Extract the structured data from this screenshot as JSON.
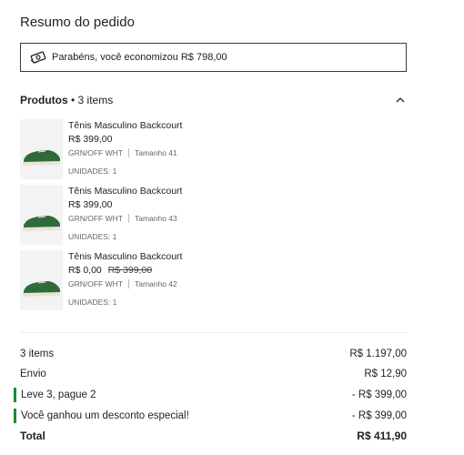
{
  "title": "Resumo do pedido",
  "savings": {
    "icon": "money-icon",
    "text": "Parabéns, você economizou R$ 798,00"
  },
  "products_header": {
    "label": "Produtos",
    "count": "• 3 items",
    "toggle_icon": "chevron-up-icon"
  },
  "products": [
    {
      "name": "Tênis Masculino Backcourt",
      "price": "R$ 399,00",
      "old_price": "",
      "color": "GRN/OFF WHT",
      "size": "Tamanho 41",
      "units": "UNIDADES: 1"
    },
    {
      "name": "Tênis Masculino Backcourt",
      "price": "R$ 399,00",
      "old_price": "",
      "color": "GRN/OFF WHT",
      "size": "Tamanho 43",
      "units": "UNIDADES: 1"
    },
    {
      "name": "Tênis Masculino Backcourt",
      "price": "R$ 0,00",
      "old_price": "R$ 399,00",
      "color": "GRN/OFF WHT",
      "size": "Tamanho 42",
      "units": "UNIDADES: 1"
    }
  ],
  "summary": {
    "items_label": "3 items",
    "items_value": "R$ 1.197,00",
    "shipping_label": "Envio",
    "shipping_value": "R$ 12,90",
    "promo1_label": "Leve 3, pague 2",
    "promo1_value": "- R$ 399,00",
    "promo2_label": "Você ganhou um desconto especial!",
    "promo2_value": "- R$ 399,00",
    "total_label": "Total",
    "total_value": "R$ 411,90"
  },
  "colors": {
    "promo_bar": "#1d8a2f",
    "shoe_green": "#2f6b3a"
  }
}
